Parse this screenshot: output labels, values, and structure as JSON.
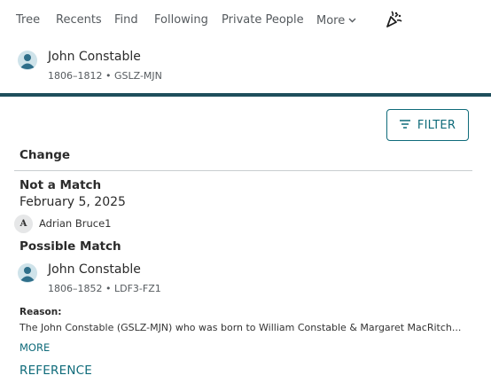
{
  "nav": {
    "items": [
      {
        "label": "Tree"
      },
      {
        "label": "Recents"
      },
      {
        "label": "Find"
      },
      {
        "label": "Following"
      },
      {
        "label": "Private People"
      },
      {
        "label": "More"
      }
    ],
    "more_icon": "chevron-down-icon",
    "celebrate_icon": "party-popper-icon"
  },
  "person": {
    "name": "John Constable",
    "meta": "1806–1812 • GSLZ-MJN",
    "icon": "person-icon"
  },
  "colors": {
    "accent": "#0f6b7a",
    "bar": "#1e4f5c",
    "avatar_head": "#2f6f8a",
    "avatar_bg": "#cfe3ea"
  },
  "filter": {
    "label": "FILTER",
    "icon": "filter-lines-icon"
  },
  "change": {
    "heading": "Change",
    "status": "Not a Match",
    "date": "February 5, 2025",
    "contributor": {
      "initial": "A",
      "name": "Adrian Bruce1"
    },
    "match_status": "Possible Match",
    "match_person": {
      "name": "John Constable",
      "meta": "1806–1852 • LDF3-FZ1"
    },
    "reason_label": "Reason:",
    "reason_text": "The John Constable (GSLZ-MJN) who was born to William Constable & Margaret MacRitch...",
    "more_label": "MORE",
    "reference_label": "REFERENCE"
  }
}
